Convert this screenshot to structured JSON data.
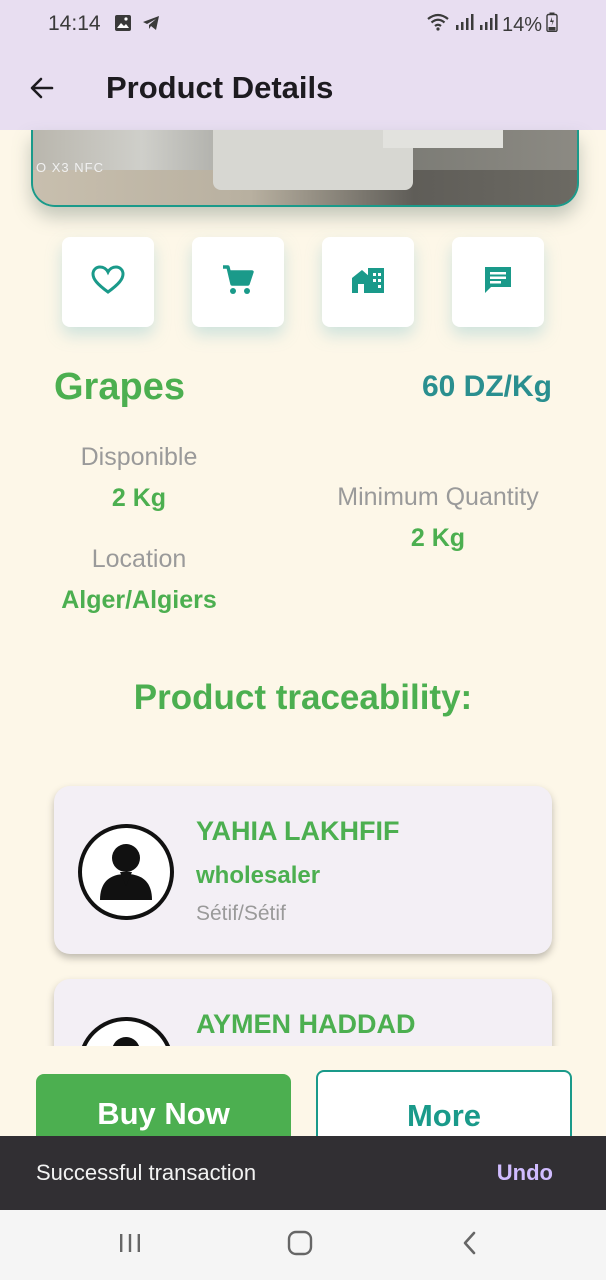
{
  "status_bar": {
    "time": "14:14",
    "battery": "14%",
    "icons": [
      "image-icon",
      "telegram-icon",
      "wifi-icon",
      "signal-icon",
      "signal-icon",
      "battery-icon"
    ]
  },
  "app_bar": {
    "title": "Product Details",
    "back_icon": "arrow-back-icon"
  },
  "image": {
    "watermark": "O X3 NFC"
  },
  "actions": [
    {
      "name": "favorite",
      "icon": "heart-outline-icon"
    },
    {
      "name": "cart",
      "icon": "shopping-cart-icon"
    },
    {
      "name": "store",
      "icon": "store-icon"
    },
    {
      "name": "message",
      "icon": "chat-icon"
    }
  ],
  "product": {
    "name": "Grapes",
    "price": "60 DZ/Kg",
    "disponible_label": "Disponible",
    "disponible_value": "2 Kg",
    "min_qty_label": "Minimum Quantity",
    "min_qty_value": "2 Kg",
    "location_label": "Location",
    "location_value": "Alger/Algiers"
  },
  "traceability": {
    "title": "Product traceability:",
    "entries": [
      {
        "name": "YAHIA LAKHFIF",
        "role": "wholesaler",
        "location": "Sétif/Sétif"
      },
      {
        "name": "AYMEN HADDAD",
        "role": "",
        "location": ""
      }
    ]
  },
  "buttons": {
    "buy": "Buy Now",
    "more": "More"
  },
  "snackbar": {
    "message": "Successful transaction",
    "action": "Undo"
  },
  "colors": {
    "primary_green": "#4caf50",
    "teal": "#1a9a8a",
    "background": "#fdf7e8",
    "app_bar": "#e8def1",
    "snackbar": "#312f33",
    "snackbar_action": "#d0bcff"
  }
}
